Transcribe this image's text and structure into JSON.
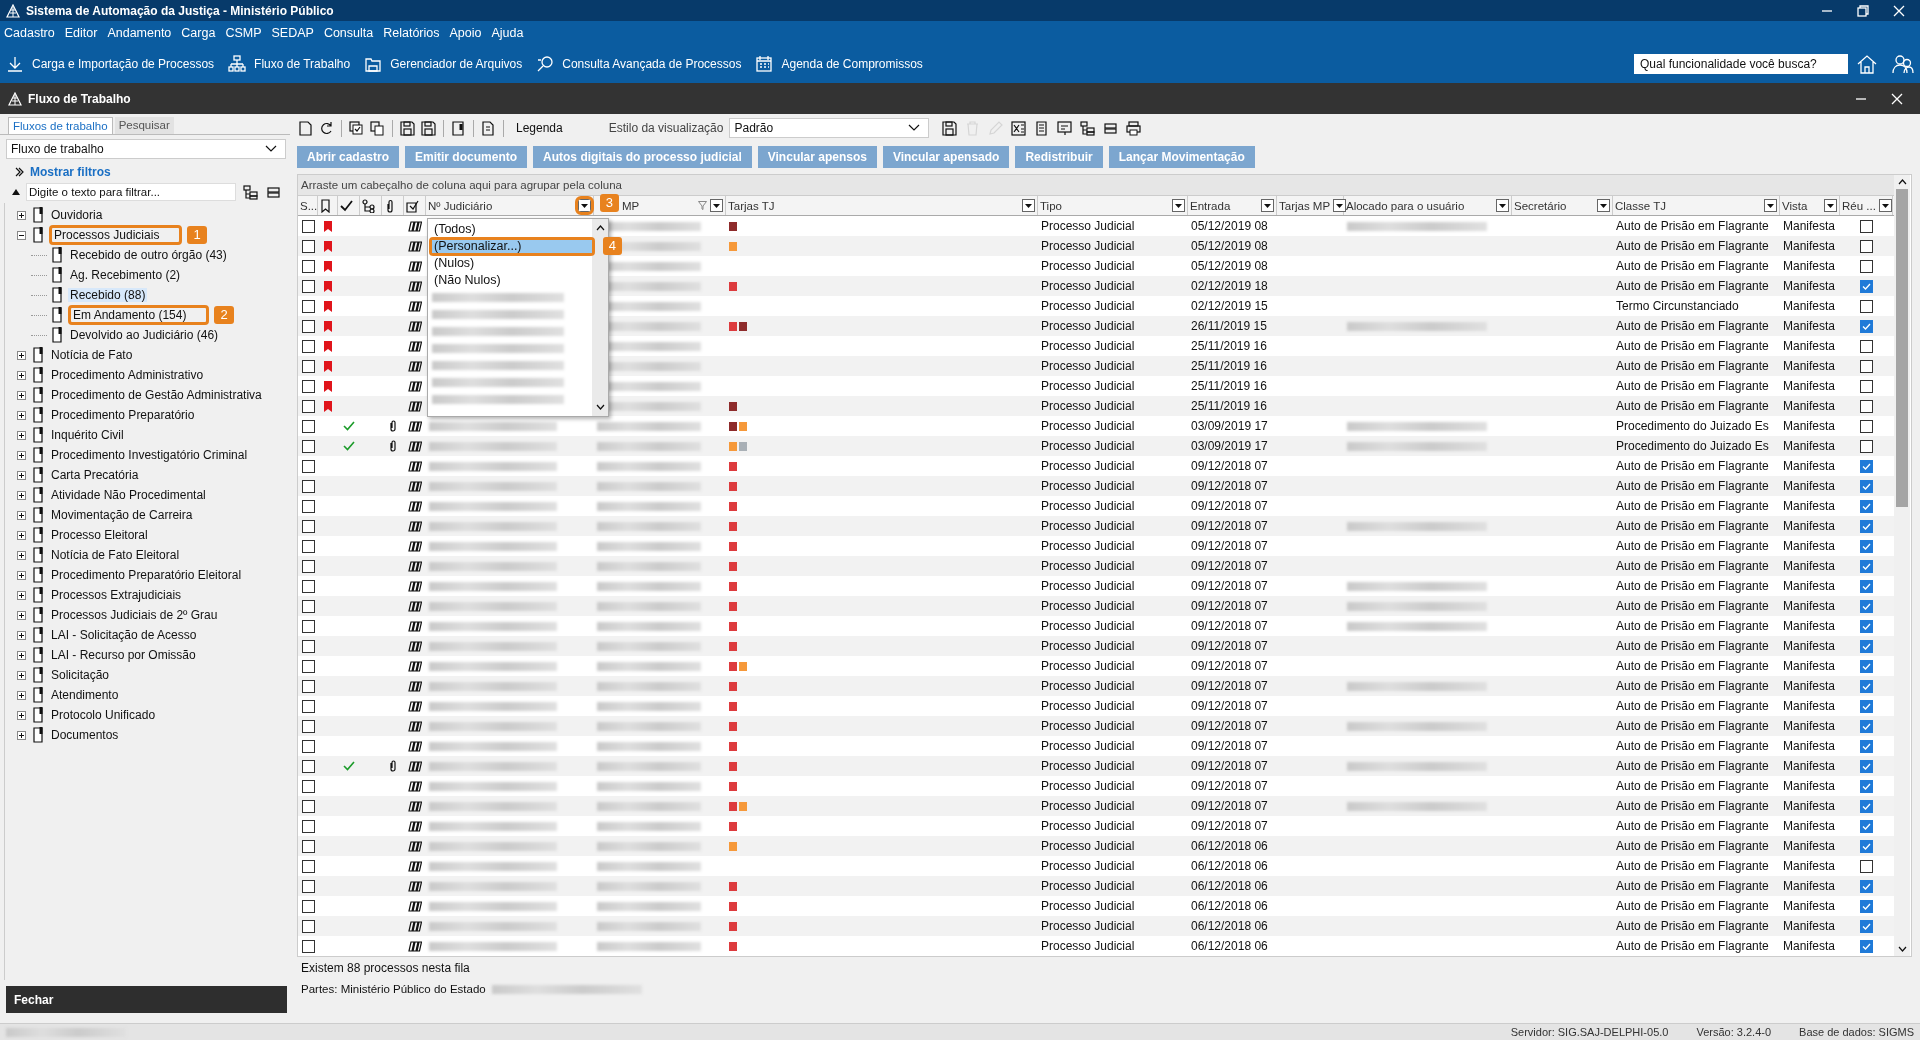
{
  "window": {
    "title": "Sistema de Automação da Justiça - Ministério Público"
  },
  "menu": [
    "Cadastro",
    "Editor",
    "Andamento",
    "Carga",
    "CSMP",
    "SEDAP",
    "Consulta",
    "Relatórios",
    "Apoio",
    "Ajuda"
  ],
  "app_toolbar": [
    "Carga e Importação de Processos",
    "Fluxo de Trabalho",
    "Gerenciador de Arquivos",
    "Consulta Avançada de Processos",
    "Agenda de Compromissos"
  ],
  "global_search": {
    "placeholder": "Qual funcionalidade você busca?"
  },
  "subwindow": {
    "title": "Fluxo de Trabalho"
  },
  "left_tabs": [
    {
      "label": "Fluxos de trabalho",
      "selected": true
    },
    {
      "label": "Pesquisar",
      "selected": false
    }
  ],
  "flow_select": {
    "value": "Fluxo de trabalho"
  },
  "show_filters": "Mostrar filtros",
  "tree_filter": {
    "placeholder": "Digite o texto para filtrar..."
  },
  "tree": [
    {
      "label": "Ouvidoria",
      "expanded": false,
      "selected": false
    },
    {
      "label": "Processos Judiciais",
      "expanded": true,
      "selected": false,
      "callout": "1",
      "children": [
        {
          "label": "Recebido de outro órgão (43)",
          "selected": false
        },
        {
          "label": "Ag. Recebimento (2)",
          "selected": false
        },
        {
          "label": "Recebido (88)",
          "selected": true
        },
        {
          "label": "Em Andamento (154)",
          "selected": false,
          "callout": "2"
        },
        {
          "label": "Devolvido ao Judiciário (46)",
          "selected": false
        }
      ]
    },
    {
      "label": "Notícia de Fato",
      "expanded": false,
      "selected": false
    },
    {
      "label": "Procedimento Administrativo",
      "expanded": false,
      "selected": false
    },
    {
      "label": "Procedimento de Gestão Administrativa",
      "expanded": false,
      "selected": false
    },
    {
      "label": "Procedimento Preparatório",
      "expanded": false,
      "selected": false
    },
    {
      "label": "Inquérito Civil",
      "expanded": false,
      "selected": false
    },
    {
      "label": "Procedimento Investigatório Criminal",
      "expanded": false,
      "selected": false
    },
    {
      "label": "Carta Precatória",
      "expanded": false,
      "selected": false
    },
    {
      "label": "Atividade Não Procedimental",
      "expanded": false,
      "selected": false
    },
    {
      "label": "Movimentação de Carreira",
      "expanded": false,
      "selected": false
    },
    {
      "label": "Processo Eleitoral",
      "expanded": false,
      "selected": false
    },
    {
      "label": "Notícia de Fato Eleitoral",
      "expanded": false,
      "selected": false
    },
    {
      "label": "Procedimento Preparatório Eleitoral",
      "expanded": false,
      "selected": false
    },
    {
      "label": "Processos Extrajudiciais",
      "expanded": false,
      "selected": false
    },
    {
      "label": "Processos Judiciais de 2º Grau",
      "expanded": false,
      "selected": false
    },
    {
      "label": "LAI - Solicitação de Acesso",
      "expanded": false,
      "selected": false
    },
    {
      "label": "LAI - Recurso por Omissão",
      "expanded": false,
      "selected": false
    },
    {
      "label": "Solicitação",
      "expanded": false,
      "selected": false
    },
    {
      "label": "Atendimento",
      "expanded": false,
      "selected": false
    },
    {
      "label": "Protocolo Unificado",
      "expanded": false,
      "selected": false
    },
    {
      "label": "Documentos",
      "expanded": false,
      "selected": false
    }
  ],
  "close_button": "Fechar",
  "grid_toolbar": {
    "legend": "Legenda",
    "style_label": "Estilo da visualização",
    "style_value": "Padrão",
    "icons_after": [
      {
        "disabled": false
      },
      {
        "disabled": true
      },
      {
        "disabled": true
      },
      {
        "disabled": false
      },
      {
        "disabled": false
      },
      {
        "disabled": false
      },
      {
        "disabled": false
      },
      {
        "disabled": false
      },
      {
        "disabled": false
      }
    ]
  },
  "action_buttons": [
    "Abrir cadastro",
    "Emitir documento",
    "Autos digitais do processo judicial",
    "Vincular apensos",
    "Vincular apensado",
    "Redistribuir",
    "Lançar Movimentação"
  ],
  "group_hint": "Arraste um cabeçalho de coluna aqui para agrupar pela coluna",
  "columns": [
    {
      "kind": "text",
      "label": "S...",
      "filter": false,
      "filtered": false
    },
    {
      "kind": "icon",
      "filter": false,
      "filtered": false
    },
    {
      "kind": "icon",
      "filter": false,
      "filtered": false
    },
    {
      "kind": "icon",
      "filter": false,
      "filtered": false
    },
    {
      "kind": "icon",
      "filter": false,
      "filtered": false
    },
    {
      "kind": "icon",
      "filter": false,
      "filtered": false
    },
    {
      "kind": "text",
      "label": "Nº Judiciário",
      "filter": true,
      "filtered": false,
      "callout": "3"
    },
    {
      "kind": "text",
      "label": "MP",
      "filter": true,
      "filtered": true
    },
    {
      "kind": "text",
      "label": "Tarjas TJ",
      "filter": true,
      "filtered": false
    },
    {
      "kind": "text",
      "label": "Tipo",
      "filter": true,
      "filtered": false
    },
    {
      "kind": "text",
      "label": "Entrada",
      "filter": true,
      "filtered": false
    },
    {
      "kind": "text",
      "label": "Tarjas MP",
      "filter": true,
      "filtered": false
    },
    {
      "kind": "text",
      "label": "Alocado para o usuário",
      "filter": true,
      "filtered": false
    },
    {
      "kind": "text",
      "label": "Secretário",
      "filter": true,
      "filtered": false
    },
    {
      "kind": "text",
      "label": "Classe TJ",
      "filter": true,
      "filtered": false
    },
    {
      "kind": "text",
      "label": "Vista",
      "filter": true,
      "filtered": false
    },
    {
      "kind": "text",
      "label": "Réu ...",
      "filter": true,
      "filtered": false
    }
  ],
  "filter_dropdown": {
    "items": [
      {
        "label": "(Todos)",
        "selected": false
      },
      {
        "label": "(Personalizar...)",
        "selected": true,
        "callout": "4"
      },
      {
        "label": "(Nulos)",
        "selected": false
      },
      {
        "label": "(Não Nulos)",
        "selected": false
      }
    ]
  },
  "rows": [
    {
      "checked": false,
      "flagged": true,
      "done": false,
      "attachment": false,
      "tarjas": [
        {
          "color": "#8e2b2b"
        }
      ],
      "tipo": "Processo Judicial",
      "entrada": "05/12/2019 08",
      "assigned_blurred": true,
      "classe": "Auto de Prisão em Flagrante",
      "vista": "Manifesta",
      "reu": false
    },
    {
      "checked": false,
      "flagged": true,
      "done": false,
      "attachment": false,
      "tarjas": [
        {
          "color": "#f6993a"
        }
      ],
      "tipo": "Processo Judicial",
      "entrada": "05/12/2019 08",
      "assigned_blurred": false,
      "classe": "Auto de Prisão em Flagrante",
      "vista": "Manifesta",
      "reu": false
    },
    {
      "checked": false,
      "flagged": true,
      "done": false,
      "attachment": false,
      "tarjas": [],
      "tipo": "Processo Judicial",
      "entrada": "05/12/2019 08",
      "assigned_blurred": false,
      "classe": "Auto de Prisão em Flagrante",
      "vista": "Manifesta",
      "reu": false
    },
    {
      "checked": false,
      "flagged": true,
      "done": false,
      "attachment": false,
      "tarjas": [
        {
          "color": "#dd3b3e"
        }
      ],
      "tipo": "Processo Judicial",
      "entrada": "02/12/2019 18",
      "assigned_blurred": false,
      "classe": "Auto de Prisão em Flagrante",
      "vista": "Manifesta",
      "reu": true
    },
    {
      "checked": false,
      "flagged": true,
      "done": false,
      "attachment": false,
      "tarjas": [],
      "tipo": "Processo Judicial",
      "entrada": "02/12/2019 15",
      "assigned_blurred": false,
      "classe": "Termo Circunstanciado",
      "vista": "Manifesta",
      "reu": false
    },
    {
      "checked": false,
      "flagged": true,
      "done": false,
      "attachment": false,
      "tarjas": [
        {
          "color": "#dd3b3e"
        },
        {
          "color": "#8e2b2b"
        }
      ],
      "tipo": "Processo Judicial",
      "entrada": "26/11/2019 15",
      "assigned_blurred": true,
      "classe": "Auto de Prisão em Flagrante",
      "vista": "Manifesta",
      "reu": true
    },
    {
      "checked": false,
      "flagged": true,
      "done": false,
      "attachment": false,
      "tarjas": [],
      "tipo": "Processo Judicial",
      "entrada": "25/11/2019 16",
      "assigned_blurred": false,
      "classe": "Auto de Prisão em Flagrante",
      "vista": "Manifesta",
      "reu": false
    },
    {
      "checked": false,
      "flagged": true,
      "done": false,
      "attachment": false,
      "tarjas": [],
      "tipo": "Processo Judicial",
      "entrada": "25/11/2019 16",
      "assigned_blurred": false,
      "classe": "Auto de Prisão em Flagrante",
      "vista": "Manifesta",
      "reu": false
    },
    {
      "checked": false,
      "flagged": true,
      "done": false,
      "attachment": false,
      "tarjas": [],
      "tipo": "Processo Judicial",
      "entrada": "25/11/2019 16",
      "assigned_blurred": false,
      "classe": "Auto de Prisão em Flagrante",
      "vista": "Manifesta",
      "reu": false
    },
    {
      "checked": false,
      "flagged": true,
      "done": false,
      "attachment": false,
      "tarjas": [
        {
          "color": "#8e2b2b"
        }
      ],
      "tipo": "Processo Judicial",
      "entrada": "25/11/2019 16",
      "assigned_blurred": false,
      "classe": "Auto de Prisão em Flagrante",
      "vista": "Manifesta",
      "reu": false
    },
    {
      "checked": false,
      "flagged": false,
      "done": true,
      "attachment": true,
      "tarjas": [
        {
          "color": "#8e2b2b"
        },
        {
          "color": "#f6993a"
        }
      ],
      "tipo": "Processo Judicial",
      "entrada": "03/09/2019 17",
      "assigned_blurred": true,
      "classe": "Procedimento do Juizado Es",
      "vista": "Manifesta",
      "reu": false
    },
    {
      "checked": false,
      "flagged": false,
      "done": true,
      "attachment": true,
      "tarjas": [
        {
          "color": "#f6993a"
        },
        {
          "color": "#a9b0b6"
        }
      ],
      "tipo": "Processo Judicial",
      "entrada": "03/09/2019 17",
      "assigned_blurred": true,
      "classe": "Procedimento do Juizado Es",
      "vista": "Manifesta",
      "reu": false
    },
    {
      "checked": false,
      "flagged": false,
      "done": false,
      "attachment": false,
      "tarjas": [
        {
          "color": "#dd3b3e"
        }
      ],
      "tipo": "Processo Judicial",
      "entrada": "09/12/2018 07",
      "assigned_blurred": false,
      "classe": "Auto de Prisão em Flagrante",
      "vista": "Manifesta",
      "reu": true
    },
    {
      "checked": false,
      "flagged": false,
      "done": false,
      "attachment": false,
      "tarjas": [
        {
          "color": "#dd3b3e"
        }
      ],
      "tipo": "Processo Judicial",
      "entrada": "09/12/2018 07",
      "assigned_blurred": false,
      "classe": "Auto de Prisão em Flagrante",
      "vista": "Manifesta",
      "reu": true
    },
    {
      "checked": false,
      "flagged": false,
      "done": false,
      "attachment": false,
      "tarjas": [
        {
          "color": "#dd3b3e"
        }
      ],
      "tipo": "Processo Judicial",
      "entrada": "09/12/2018 07",
      "assigned_blurred": false,
      "classe": "Auto de Prisão em Flagrante",
      "vista": "Manifesta",
      "reu": true
    },
    {
      "checked": false,
      "flagged": false,
      "done": false,
      "attachment": false,
      "tarjas": [
        {
          "color": "#dd3b3e"
        }
      ],
      "tipo": "Processo Judicial",
      "entrada": "09/12/2018 07",
      "assigned_blurred": true,
      "classe": "Auto de Prisão em Flagrante",
      "vista": "Manifesta",
      "reu": true
    },
    {
      "checked": false,
      "flagged": false,
      "done": false,
      "attachment": false,
      "tarjas": [
        {
          "color": "#dd3b3e"
        }
      ],
      "tipo": "Processo Judicial",
      "entrada": "09/12/2018 07",
      "assigned_blurred": false,
      "classe": "Auto de Prisão em Flagrante",
      "vista": "Manifesta",
      "reu": true
    },
    {
      "checked": false,
      "flagged": false,
      "done": false,
      "attachment": false,
      "tarjas": [
        {
          "color": "#dd3b3e"
        }
      ],
      "tipo": "Processo Judicial",
      "entrada": "09/12/2018 07",
      "assigned_blurred": false,
      "classe": "Auto de Prisão em Flagrante",
      "vista": "Manifesta",
      "reu": true
    },
    {
      "checked": false,
      "flagged": false,
      "done": false,
      "attachment": false,
      "tarjas": [
        {
          "color": "#dd3b3e"
        }
      ],
      "tipo": "Processo Judicial",
      "entrada": "09/12/2018 07",
      "assigned_blurred": true,
      "classe": "Auto de Prisão em Flagrante",
      "vista": "Manifesta",
      "reu": true
    },
    {
      "checked": false,
      "flagged": false,
      "done": false,
      "attachment": false,
      "tarjas": [
        {
          "color": "#dd3b3e"
        }
      ],
      "tipo": "Processo Judicial",
      "entrada": "09/12/2018 07",
      "assigned_blurred": true,
      "classe": "Auto de Prisão em Flagrante",
      "vista": "Manifesta",
      "reu": true
    },
    {
      "checked": false,
      "flagged": false,
      "done": false,
      "attachment": false,
      "tarjas": [
        {
          "color": "#dd3b3e"
        }
      ],
      "tipo": "Processo Judicial",
      "entrada": "09/12/2018 07",
      "assigned_blurred": true,
      "classe": "Auto de Prisão em Flagrante",
      "vista": "Manifesta",
      "reu": true
    },
    {
      "checked": false,
      "flagged": false,
      "done": false,
      "attachment": false,
      "tarjas": [
        {
          "color": "#dd3b3e"
        }
      ],
      "tipo": "Processo Judicial",
      "entrada": "09/12/2018 07",
      "assigned_blurred": false,
      "classe": "Auto de Prisão em Flagrante",
      "vista": "Manifesta",
      "reu": true
    },
    {
      "checked": false,
      "flagged": false,
      "done": false,
      "attachment": false,
      "tarjas": [
        {
          "color": "#dd3b3e"
        },
        {
          "color": "#f6993a"
        }
      ],
      "tipo": "Processo Judicial",
      "entrada": "09/12/2018 07",
      "assigned_blurred": false,
      "classe": "Auto de Prisão em Flagrante",
      "vista": "Manifesta",
      "reu": true
    },
    {
      "checked": false,
      "flagged": false,
      "done": false,
      "attachment": false,
      "tarjas": [
        {
          "color": "#dd3b3e"
        }
      ],
      "tipo": "Processo Judicial",
      "entrada": "09/12/2018 07",
      "assigned_blurred": true,
      "classe": "Auto de Prisão em Flagrante",
      "vista": "Manifesta",
      "reu": true
    },
    {
      "checked": false,
      "flagged": false,
      "done": false,
      "attachment": false,
      "tarjas": [
        {
          "color": "#dd3b3e"
        }
      ],
      "tipo": "Processo Judicial",
      "entrada": "09/12/2018 07",
      "assigned_blurred": false,
      "classe": "Auto de Prisão em Flagrante",
      "vista": "Manifesta",
      "reu": true
    },
    {
      "checked": false,
      "flagged": false,
      "done": false,
      "attachment": false,
      "tarjas": [
        {
          "color": "#dd3b3e"
        }
      ],
      "tipo": "Processo Judicial",
      "entrada": "09/12/2018 07",
      "assigned_blurred": true,
      "classe": "Auto de Prisão em Flagrante",
      "vista": "Manifesta",
      "reu": true
    },
    {
      "checked": false,
      "flagged": false,
      "done": false,
      "attachment": false,
      "tarjas": [
        {
          "color": "#dd3b3e"
        }
      ],
      "tipo": "Processo Judicial",
      "entrada": "09/12/2018 07",
      "assigned_blurred": false,
      "classe": "Auto de Prisão em Flagrante",
      "vista": "Manifesta",
      "reu": true
    },
    {
      "checked": false,
      "flagged": false,
      "done": true,
      "attachment": true,
      "tarjas": [
        {
          "color": "#dd3b3e"
        }
      ],
      "tipo": "Processo Judicial",
      "entrada": "09/12/2018 07",
      "assigned_blurred": true,
      "classe": "Auto de Prisão em Flagrante",
      "vista": "Manifesta",
      "reu": true
    },
    {
      "checked": false,
      "flagged": false,
      "done": false,
      "attachment": false,
      "tarjas": [
        {
          "color": "#dd3b3e"
        }
      ],
      "tipo": "Processo Judicial",
      "entrada": "09/12/2018 07",
      "assigned_blurred": false,
      "classe": "Auto de Prisão em Flagrante",
      "vista": "Manifesta",
      "reu": true
    },
    {
      "checked": false,
      "flagged": false,
      "done": false,
      "attachment": false,
      "tarjas": [
        {
          "color": "#dd3b3e"
        },
        {
          "color": "#f6993a"
        }
      ],
      "tipo": "Processo Judicial",
      "entrada": "09/12/2018 07",
      "assigned_blurred": true,
      "classe": "Auto de Prisão em Flagrante",
      "vista": "Manifesta",
      "reu": true
    },
    {
      "checked": false,
      "flagged": false,
      "done": false,
      "attachment": false,
      "tarjas": [
        {
          "color": "#dd3b3e"
        }
      ],
      "tipo": "Processo Judicial",
      "entrada": "09/12/2018 07",
      "assigned_blurred": false,
      "classe": "Auto de Prisão em Flagrante",
      "vista": "Manifesta",
      "reu": true
    },
    {
      "checked": false,
      "flagged": false,
      "done": false,
      "attachment": false,
      "tarjas": [
        {
          "color": "#f6993a"
        }
      ],
      "tipo": "Processo Judicial",
      "entrada": "06/12/2018 06",
      "assigned_blurred": false,
      "classe": "Auto de Prisão em Flagrante",
      "vista": "Manifesta",
      "reu": true
    },
    {
      "checked": false,
      "flagged": false,
      "done": false,
      "attachment": false,
      "tarjas": [],
      "tipo": "Processo Judicial",
      "entrada": "06/12/2018 06",
      "assigned_blurred": false,
      "classe": "Auto de Prisão em Flagrante",
      "vista": "Manifesta",
      "reu": false
    },
    {
      "checked": false,
      "flagged": false,
      "done": false,
      "attachment": false,
      "tarjas": [
        {
          "color": "#dd3b3e"
        }
      ],
      "tipo": "Processo Judicial",
      "entrada": "06/12/2018 06",
      "assigned_blurred": false,
      "classe": "Auto de Prisão em Flagrante",
      "vista": "Manifesta",
      "reu": true
    },
    {
      "checked": false,
      "flagged": false,
      "done": false,
      "attachment": false,
      "tarjas": [
        {
          "color": "#dd3b3e"
        }
      ],
      "tipo": "Processo Judicial",
      "entrada": "06/12/2018 06",
      "assigned_blurred": false,
      "classe": "Auto de Prisão em Flagrante",
      "vista": "Manifesta",
      "reu": true
    },
    {
      "checked": false,
      "flagged": false,
      "done": false,
      "attachment": false,
      "tarjas": [
        {
          "color": "#dd3b3e"
        }
      ],
      "tipo": "Processo Judicial",
      "entrada": "06/12/2018 06",
      "assigned_blurred": false,
      "classe": "Auto de Prisão em Flagrante",
      "vista": "Manifesta",
      "reu": true
    },
    {
      "checked": false,
      "flagged": false,
      "done": false,
      "attachment": false,
      "tarjas": [
        {
          "color": "#dd3b3e"
        }
      ],
      "tipo": "Processo Judicial",
      "entrada": "06/12/2018 06",
      "assigned_blurred": false,
      "classe": "Auto de Prisão em Flagrante",
      "vista": "Manifesta",
      "reu": true
    }
  ],
  "footer": {
    "count": "Existem 88 processos nesta fila",
    "parties": "Partes: Ministério Público do Estado"
  },
  "status_bar": {
    "server": "Servidor: SIG.SAJ-DELPHI-05.0",
    "version": "Versão: 3.2.4-0",
    "database": "Base de dados: SIGMS"
  }
}
